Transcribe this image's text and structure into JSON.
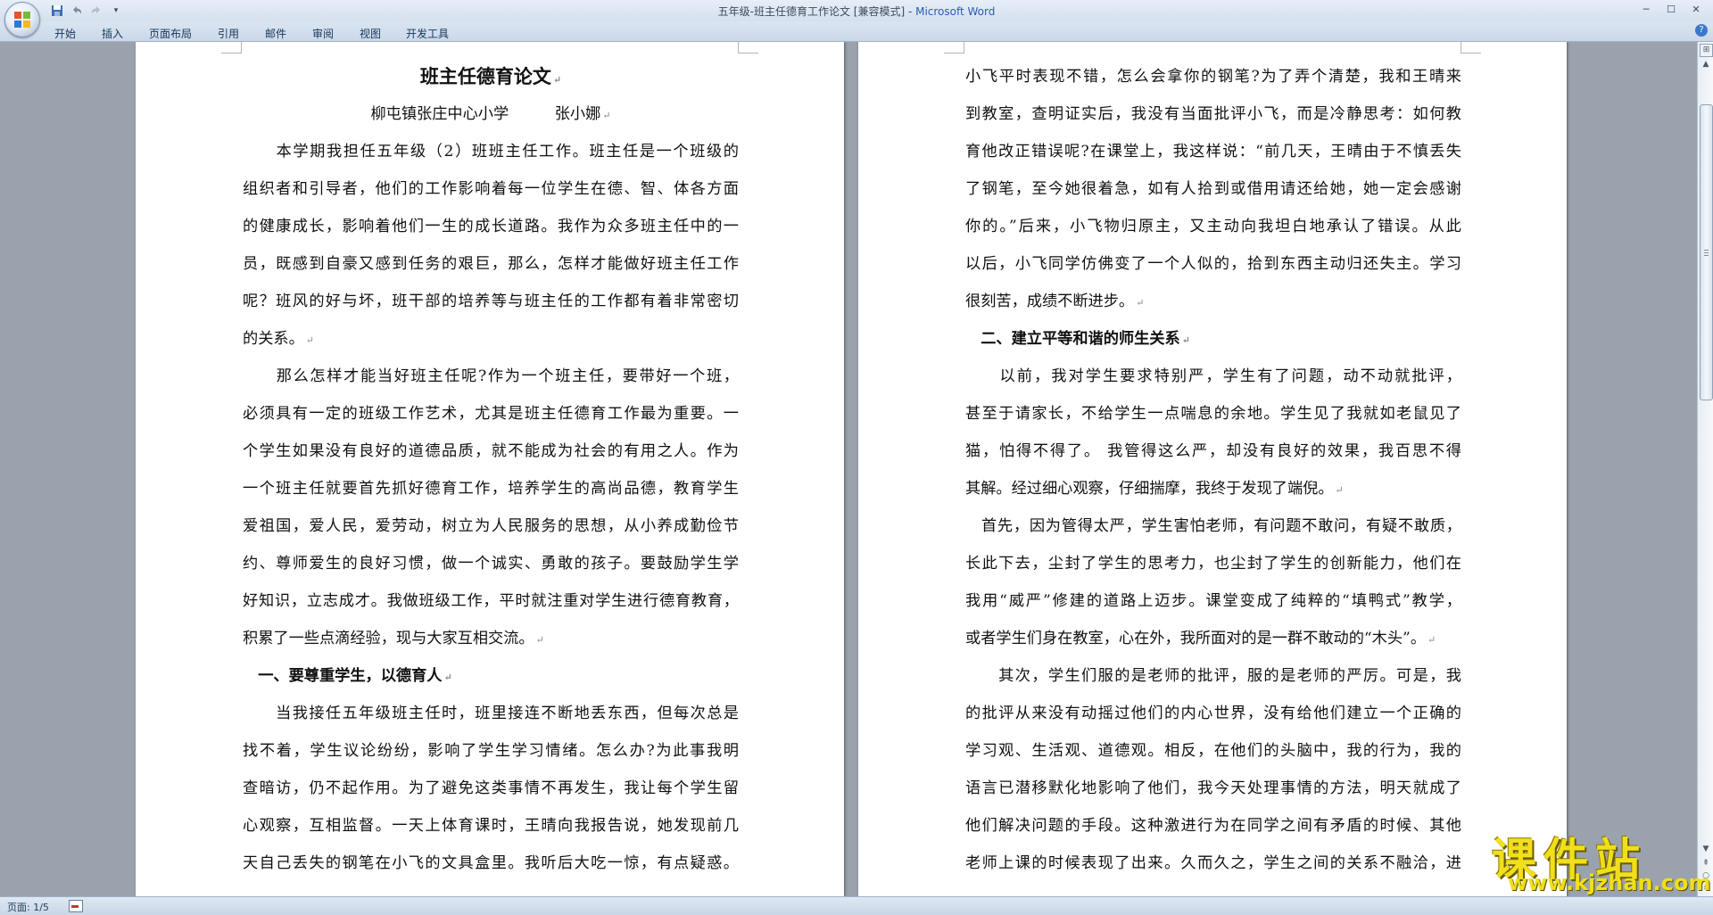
{
  "window": {
    "title_doc": "五年级-班主任德育工作论文 [兼容模式] - ",
    "title_app": "Microsoft Word",
    "minimize_icon": "minimize-icon",
    "maximize_icon": "maximize-icon",
    "close_icon": "close-icon"
  },
  "quick_access": {
    "save": "save-icon",
    "undo": "undo-icon",
    "redo": "redo-icon",
    "customize": "customize-qat-icon"
  },
  "ribbon": {
    "tabs": [
      "开始",
      "插入",
      "页面布局",
      "引用",
      "邮件",
      "审阅",
      "视图",
      "开发工具"
    ],
    "help": "?"
  },
  "document": {
    "left_page": {
      "title": "班主任德育论文",
      "author_line": "柳屯镇张庄中心小学　　　张小娜",
      "lines": [
        "　　本学期我担任五年级（2）班班主任工作。班主任是一个班级的",
        "组织者和引导者，他们的工作影响着每一位学生在德、智、体各方面",
        "的健康成长，影响着他们一生的成长道路。我作为众多班主任中的一",
        "员，既感到自豪又感到任务的艰巨，那么，怎样才能做好班主任工作",
        "呢？班风的好与坏，班干部的培养等与班主任的工作都有着非常密切",
        "的关系。",
        "　　那么怎样才能当好班主任呢?作为一个班主任，要带好一个班，",
        "必须具有一定的班级工作艺术，尤其是班主任德育工作最为重要。一",
        "个学生如果没有良好的道德品质，就不能成为社会的有用之人。作为",
        "一个班主任就要首先抓好德育工作，培养学生的高尚品德，教育学生",
        "爱祖国，爱人民，爱劳动，树立为人民服务的思想，从小养成勤俭节",
        "约、尊师爱生的良好习惯，做一个诚实、勇敢的孩子。要鼓励学生学",
        "好知识，立志成才。我做班级工作，平时就注重对学生进行德育教育，",
        "积累了一些点滴经验，现与大家互相交流。",
        "　一、要尊重学生，以德育人",
        "　　当我接任五年级班主任时，班里接连不断地丢东西，但每次总是",
        "找不着，学生议论纷纷，影响了学生学习情绪。怎么办?为此事我明",
        "查暗访，仍不起作用。为了避免这类事情不再发生，我让每个学生留",
        "心观察，互相监督。一天上体育课时，王晴向我报告说，她发现前几",
        "天自己丢失的钢笔在小飞的文具盒里。我听后大吃一惊，有点疑惑。"
      ]
    },
    "right_page": {
      "lines": [
        "小飞平时表现不错，怎么会拿你的钢笔?为了弄个清楚，我和王晴来",
        "到教室，查明证实后，我没有当面批评小飞，而是冷静思考：如何教",
        "育他改正错误呢?在课堂上，我这样说：“前几天，王晴由于不慎丢失",
        "了钢笔，至今她很着急，如有人拾到或借用请还给她，她一定会感谢",
        "你的。”后来，小飞物归原主，又主动向我坦白地承认了错误。从此",
        "以后，小飞同学仿佛变了一个人似的，拾到东西主动归还失主。学习",
        "很刻苦，成绩不断进步。",
        "　二、建立平等和谐的师生关系",
        "　　以前，我对学生要求特别严，学生有了问题，动不动就批评，",
        "甚至于请家长，不给学生一点喘息的余地。学生见了我就如老鼠见了",
        "猫，怕得不得了。 我管得这么严，却没有良好的效果，我百思不得",
        "其解。经过细心观察，仔细揣摩，我终于发现了端倪。",
        "　首先，因为管得太严，学生害怕老师，有问题不敢问，有疑不敢质，",
        "长此下去，尘封了学生的思考力，也尘封了学生的创新能力，他们在",
        "我用“威严”修建的道路上迈步。课堂变成了纯粹的“填鸭式”教学，",
        "或者学生们身在教室，心在外，我所面对的是一群不敢动的“木头”。",
        "　　其次，学生们服的是老师的批评，服的是老师的严厉。可是，我",
        "的批评从来没有动摇过他们的内心世界，没有给他们建立一个正确的",
        "学习观、生活观、道德观。相反，在他们的头脑中，我的行为，我的",
        "语言已潜移默化地影响了他们，我今天处理事情的方法，明天就成了",
        "他们解决问题的手段。这种激进行为在同学之间有矛盾的时候、其他",
        "老师上课的时候表现了出来。久而久之，学生之间的关系不融洽，进"
      ]
    },
    "paragraph_mark": "↵"
  },
  "status_bar": {
    "page_info": "页面: 1/5",
    "track_icon": "track-changes-icon"
  },
  "watermark": {
    "text": "课件站",
    "url": "www.kjzhan.com"
  },
  "colors": {
    "accent": "#2a5db0",
    "workspace": "#9aa3ad",
    "watermark": "#f0df1a"
  }
}
